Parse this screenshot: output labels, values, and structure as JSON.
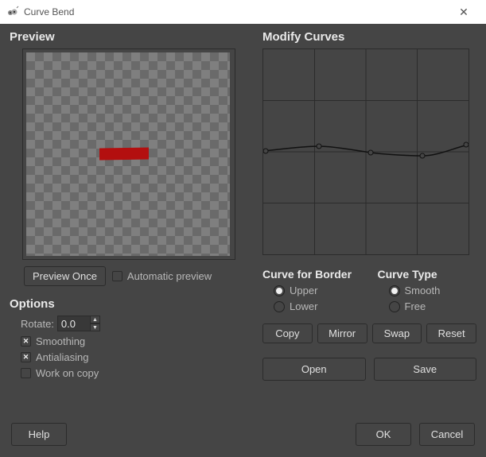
{
  "window": {
    "title": "Curve Bend"
  },
  "preview": {
    "heading": "Preview",
    "preview_once": "Preview Once",
    "automatic_preview": "Automatic preview"
  },
  "options": {
    "heading": "Options",
    "rotate_label": "Rotate:",
    "rotate_value": "0.0",
    "smoothing": "Smoothing",
    "antialiasing": "Antialiasing",
    "work_on_copy": "Work on copy"
  },
  "modify": {
    "heading": "Modify Curves",
    "curve_for_border": "Curve for Border",
    "upper": "Upper",
    "lower": "Lower",
    "curve_type": "Curve Type",
    "smooth": "Smooth",
    "free": "Free",
    "copy": "Copy",
    "mirror": "Mirror",
    "swap": "Swap",
    "reset": "Reset",
    "open": "Open",
    "save": "Save"
  },
  "footer": {
    "help": "Help",
    "ok": "OK",
    "cancel": "Cancel"
  }
}
